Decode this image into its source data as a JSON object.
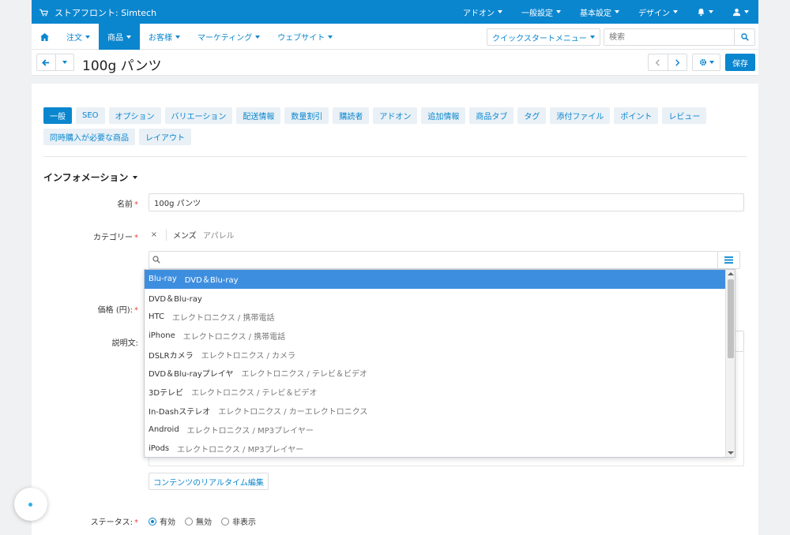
{
  "topbar": {
    "store_title": "ストアフロント: Simtech",
    "menu": [
      {
        "label": "アドオン"
      },
      {
        "label": "一般設定"
      },
      {
        "label": "基本設定"
      },
      {
        "label": "デザイン"
      }
    ]
  },
  "nav": {
    "home_icon": "home-icon",
    "items": [
      {
        "label": "注文"
      },
      {
        "label": "商品"
      },
      {
        "label": "お客様"
      },
      {
        "label": "マーケティング"
      },
      {
        "label": "ウェブサイト"
      }
    ],
    "quickstart_label": "クイックスタートメニュー",
    "search_placeholder": "検索"
  },
  "titlebar": {
    "title": "100g パンツ",
    "save_label": "保存"
  },
  "tabs": [
    {
      "label": "一般"
    },
    {
      "label": "SEO"
    },
    {
      "label": "オプション"
    },
    {
      "label": "バリエーション"
    },
    {
      "label": "配送情報"
    },
    {
      "label": "数量割引"
    },
    {
      "label": "購読者"
    },
    {
      "label": "アドオン"
    },
    {
      "label": "追加情報"
    },
    {
      "label": "商品タブ"
    },
    {
      "label": "タグ"
    },
    {
      "label": "添付ファイル"
    },
    {
      "label": "ポイント"
    },
    {
      "label": "レビュー"
    },
    {
      "label": "同時購入が必要な商品"
    },
    {
      "label": "レイアウト"
    }
  ],
  "section": {
    "title": "インフォメーション"
  },
  "form": {
    "name_label": "名前",
    "name_value": "100g パンツ",
    "category_label": "カテゴリー",
    "category_selected": "メンズ",
    "category_selected_path": "アパレル",
    "price_label": "価格 (円):",
    "description_label": "説明文:",
    "required_mark": "*",
    "remove_mark": "×",
    "editor_button": "コンテンツのリアルタイム編集",
    "status_label": "ステータス:",
    "status_options": [
      {
        "label": "有効"
      },
      {
        "label": "無効"
      },
      {
        "label": "非表示"
      }
    ]
  },
  "dropdown": {
    "options": [
      {
        "name": "Blu-ray",
        "path": "DVD＆Blu-ray"
      },
      {
        "name": "DVD＆Blu-ray",
        "path": ""
      },
      {
        "name": "HTC",
        "path": "エレクトロニクス / 携帯電話"
      },
      {
        "name": "iPhone",
        "path": "エレクトロニクス / 携帯電話"
      },
      {
        "name": "DSLRカメラ",
        "path": "エレクトロニクス / カメラ"
      },
      {
        "name": "DVD＆Blu-rayプレイヤ",
        "path": "エレクトロニクス / テレビ＆ビデオ"
      },
      {
        "name": "3Dテレビ",
        "path": "エレクトロニクス / テレビ＆ビデオ"
      },
      {
        "name": "In-Dashステレオ",
        "path": "エレクトロニクス / カーエレクトロニクス"
      },
      {
        "name": "Android",
        "path": "エレクトロニクス / MP3プレイヤー"
      },
      {
        "name": "iPods",
        "path": "エレクトロニクス / MP3プレイヤー"
      }
    ]
  },
  "colors": {
    "primary": "#0a86cf",
    "highlight": "#3e8ee0",
    "required": "#e0463c"
  }
}
